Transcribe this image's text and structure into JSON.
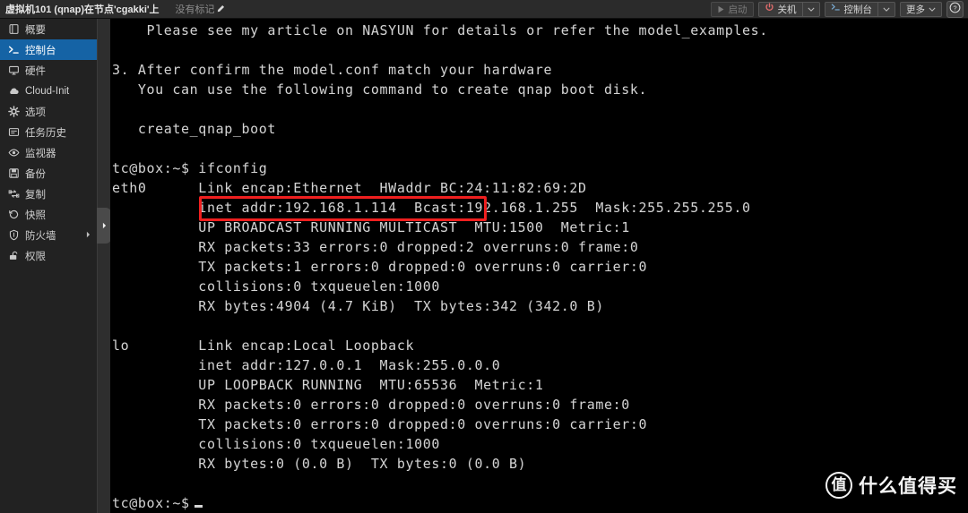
{
  "header": {
    "title": "虚拟机101 (qnap)在节点'cgakki'上",
    "tag_label": "没有标记",
    "edit_icon": "pencil-icon",
    "buttons": {
      "start": {
        "label": "启动",
        "icon": "play-icon",
        "state": "disabled"
      },
      "shutdown": {
        "label": "关机",
        "icon": "power-icon",
        "caret": "chevron-down-icon"
      },
      "console": {
        "label": "控制台",
        "icon": "terminal-prompt-icon",
        "caret": "chevron-down-icon"
      },
      "more": {
        "label": "更多",
        "caret": "chevron-down-icon"
      },
      "help": {
        "label": "?",
        "icon": "help-icon"
      }
    }
  },
  "sidebar": {
    "items": [
      {
        "label": "概要",
        "icon": "book-icon",
        "active": false,
        "submenu": false
      },
      {
        "label": "控制台",
        "icon": "terminal-icon",
        "active": true,
        "submenu": false
      },
      {
        "label": "硬件",
        "icon": "monitor-icon",
        "active": false,
        "submenu": false
      },
      {
        "label": "Cloud-Init",
        "icon": "cloud-icon",
        "active": false,
        "submenu": false
      },
      {
        "label": "选项",
        "icon": "gear-icon",
        "active": false,
        "submenu": false
      },
      {
        "label": "任务历史",
        "icon": "list-icon",
        "active": false,
        "submenu": false
      },
      {
        "label": "监视器",
        "icon": "eye-icon",
        "active": false,
        "submenu": false
      },
      {
        "label": "备份",
        "icon": "save-disk-icon",
        "active": false,
        "submenu": false
      },
      {
        "label": "复制",
        "icon": "replicate-icon",
        "active": false,
        "submenu": false
      },
      {
        "label": "快照",
        "icon": "history-icon",
        "active": false,
        "submenu": false
      },
      {
        "label": "防火墙",
        "icon": "shield-icon",
        "active": false,
        "submenu": true
      },
      {
        "label": "权限",
        "icon": "unlock-icon",
        "active": false,
        "submenu": false
      }
    ],
    "submenu_arrow_icon": "chevron-right-icon"
  },
  "splitter": {
    "handle_icon": "chevron-right-icon"
  },
  "terminal": {
    "lines": [
      "    Please see my article on NASYUN for details or refer the model_examples.",
      "",
      "3. After confirm the model.conf match your hardware",
      "   You can use the following command to create qnap boot disk.",
      "",
      "   create_qnap_boot",
      "",
      "tc@box:~$ ifconfig",
      "eth0      Link encap:Ethernet  HWaddr BC:24:11:82:69:2D",
      "          inet addr:192.168.1.114  Bcast:192.168.1.255  Mask:255.255.255.0",
      "          UP BROADCAST RUNNING MULTICAST  MTU:1500  Metric:1",
      "          RX packets:33 errors:0 dropped:2 overruns:0 frame:0",
      "          TX packets:1 errors:0 dropped:0 overruns:0 carrier:0",
      "          collisions:0 txqueuelen:1000",
      "          RX bytes:4904 (4.7 KiB)  TX bytes:342 (342.0 B)",
      "",
      "lo        Link encap:Local Loopback",
      "          inet addr:127.0.0.1  Mask:255.0.0.0",
      "          UP LOOPBACK RUNNING  MTU:65536  Metric:1",
      "          RX packets:0 errors:0 dropped:0 overruns:0 frame:0",
      "          TX packets:0 errors:0 dropped:0 overruns:0 carrier:0",
      "          collisions:0 txqueuelen:1000",
      "          RX bytes:0 (0.0 B)  TX bytes:0 (0.0 B)",
      ""
    ],
    "prompt": "tc@box:~$",
    "cursor": "block-cursor",
    "highlight": {
      "text": "inet addr:192.168.1.114",
      "color": "#ef1f1f"
    }
  },
  "watermark": {
    "badge": "值",
    "text": "什么值得买"
  },
  "colors": {
    "accent": "#1563a5",
    "header_bg": "#2b2b2b",
    "sidebar_bg": "#222222",
    "terminal_bg": "#000000",
    "terminal_fg": "#d4d4d4",
    "highlight": "#ef1f1f"
  }
}
